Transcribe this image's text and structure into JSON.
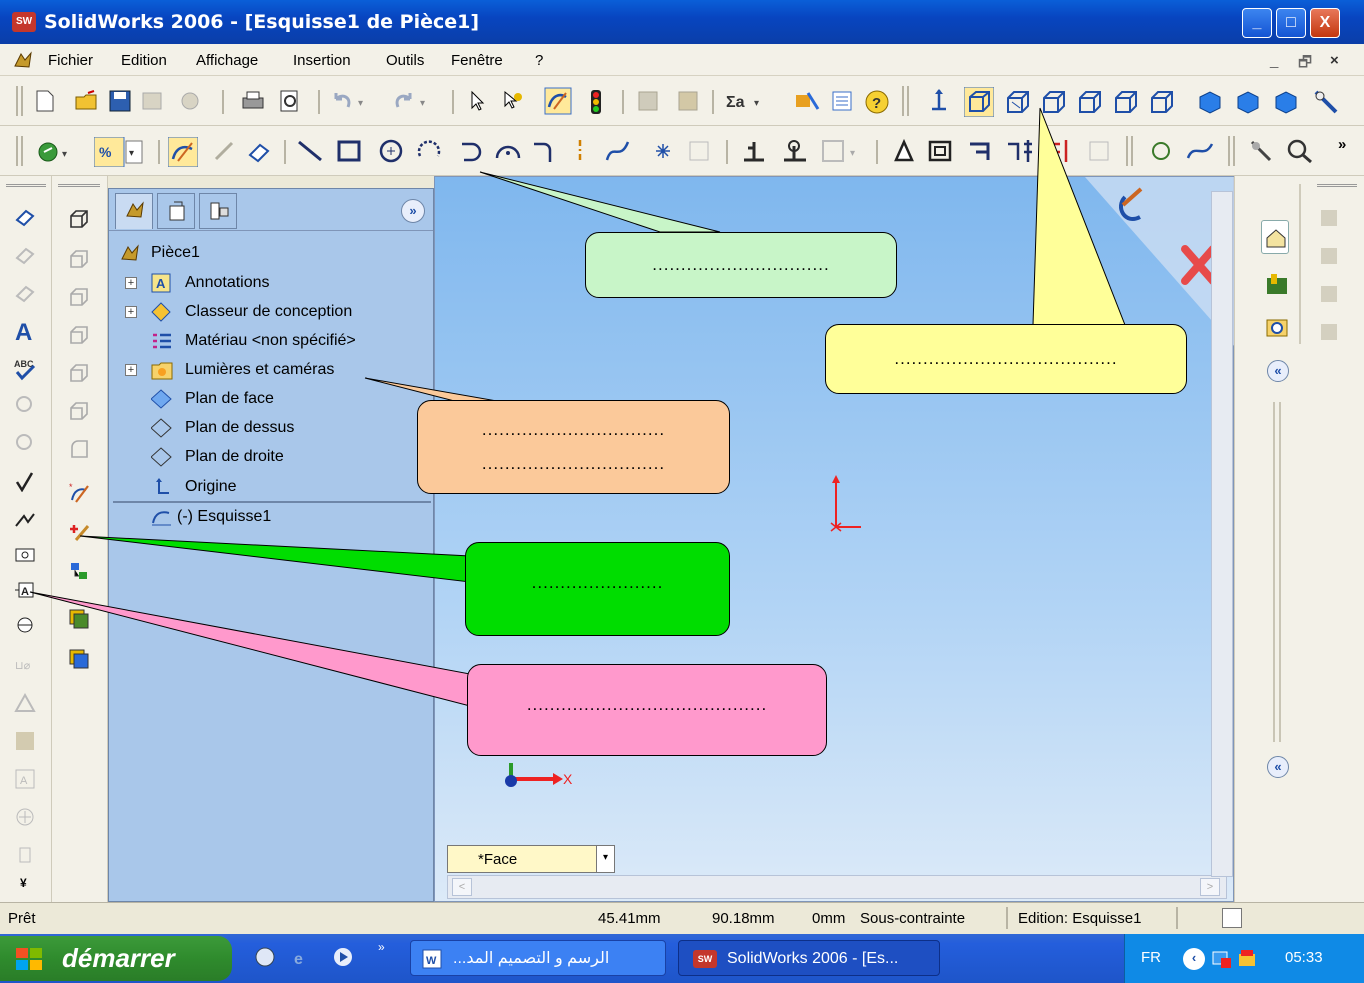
{
  "window": {
    "title": "SolidWorks 2006 - [Esquisse1 de Pièce1]",
    "logo_text": "SW",
    "buttons": [
      "_",
      "□",
      "X"
    ]
  },
  "menu": {
    "items": [
      "Fichier",
      "Edition",
      "Affichage",
      "Insertion",
      "Outils",
      "Fenêtre",
      "?"
    ],
    "doc_controls": [
      "_",
      "🗗",
      "×"
    ]
  },
  "feature_tree": {
    "root": "Pièce1",
    "expand_button": "»",
    "items": [
      {
        "label": "Annotations",
        "icon": "annotation-icon",
        "expandable": true
      },
      {
        "label": "Classeur de conception",
        "icon": "design-binder-icon",
        "expandable": true
      },
      {
        "label": "Matériau <non spécifié>",
        "icon": "material-icon",
        "expandable": false
      },
      {
        "label": "Lumières et caméras",
        "icon": "lights-cameras-icon",
        "expandable": true
      },
      {
        "label": "Plan de face",
        "icon": "plane-icon",
        "expandable": false
      },
      {
        "label": "Plan de dessus",
        "icon": "plane-icon",
        "expandable": false
      },
      {
        "label": "Plan de droite",
        "icon": "plane-icon",
        "expandable": false
      },
      {
        "label": "Origine",
        "icon": "origin-icon",
        "expandable": false
      },
      {
        "label": "(-) Esquisse1",
        "icon": "sketch-icon",
        "expandable": false
      }
    ]
  },
  "graphics": {
    "view_select_value": "*Face",
    "triad_x_label": "X"
  },
  "callouts": {
    "c1": "...............................",
    "c2": ".......................................",
    "c3_line1": "................................",
    "c3_line2": "................................",
    "c4": ".......................",
    "c5": ".........................................."
  },
  "taskpane": {
    "collapse_label": "«"
  },
  "status": {
    "ready": "Prêt",
    "x": "45.41mm",
    "y": "90.18mm",
    "z": "0mm",
    "constraint": "Sous-contrainte",
    "mode": "Edition: Esquisse1"
  },
  "taskbar": {
    "start": "démarrer",
    "tasks": [
      "...الرسم و التصميم المد",
      "SolidWorks 2006 - [Es..."
    ],
    "lang": "FR",
    "time": "05:33",
    "chevron": "»"
  },
  "colors": {
    "titlebar": "#0845c0",
    "graphics_top": "#7fb7ee",
    "callout_green_light": "#c8f5c8",
    "callout_yellow": "#ffff99",
    "callout_orange": "#fbc99a",
    "callout_green": "#00dd00",
    "callout_pink": "#ff99cc"
  }
}
